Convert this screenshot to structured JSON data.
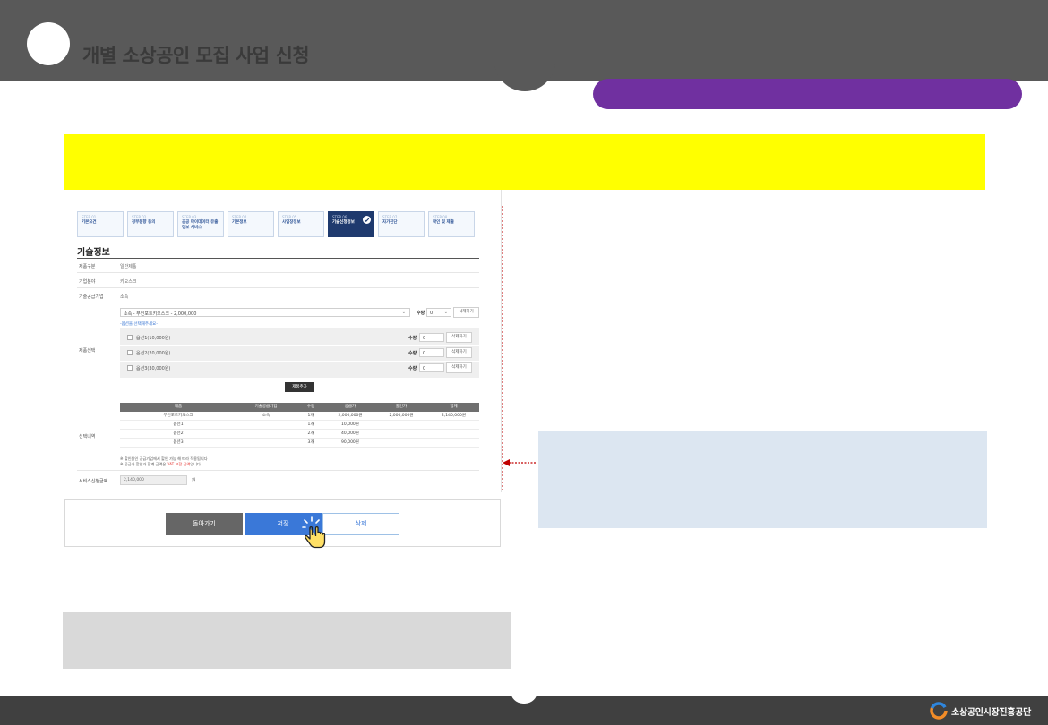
{
  "header": {
    "title": "개별 소상공인 모집 사업 신청"
  },
  "steps": [
    {
      "num": "STEP 01",
      "label": "기본요건"
    },
    {
      "num": "STEP 02",
      "label": "정부동향 동의"
    },
    {
      "num": "STEP 03",
      "label": "공공 마이데이터 유출정보 서비스"
    },
    {
      "num": "STEP 04",
      "label": "기본정보"
    },
    {
      "num": "STEP 05",
      "label": "사업장정보"
    },
    {
      "num": "STEP 06",
      "label": "기술신청정보"
    },
    {
      "num": "STEP 07",
      "label": "자가진단"
    },
    {
      "num": "STEP 08",
      "label": "확인 및 제출"
    }
  ],
  "tech": {
    "heading": "기술정보",
    "rows": [
      {
        "key": "제품구분",
        "value": "일반제품"
      },
      {
        "key": "기업분야",
        "value": "키오스크"
      },
      {
        "key": "기술공급기업",
        "value": "소속"
      }
    ],
    "product_select": {
      "label": "제품선택",
      "value": "소속 - 무인포트키오스크 - 2,000,000",
      "qty_label": "수량",
      "qty_value": "0",
      "remove_label": "삭제하기"
    },
    "option_hint": "-옵션을 선택해주세요-",
    "options": [
      {
        "label": "옵션1(10,000원)",
        "qty": "0",
        "remove": "삭제하기"
      },
      {
        "label": "옵션2(20,000원)",
        "qty": "0",
        "remove": "삭제하기"
      },
      {
        "label": "옵션3(30,000원)",
        "qty": "0",
        "remove": "삭제하기"
      }
    ],
    "add_button": "제품추가",
    "selection_label": "선택내역",
    "table_headers": [
      "제품",
      "기술공급기업",
      "수량",
      "공급가",
      "할인가",
      "합계"
    ],
    "table_rows": [
      [
        "무인포트키오스크",
        "소속",
        "1개",
        "2,000,000원",
        "2,000,000원",
        "2,140,000원"
      ],
      [
        "옵션1",
        "",
        "1개",
        "10,000원",
        "",
        ""
      ],
      [
        "옵션2",
        "",
        "2개",
        "40,000원",
        "",
        ""
      ],
      [
        "옵션3",
        "",
        "3개",
        "90,000원",
        ""
      ]
    ],
    "notes": [
      "※ 할인원인 공급기업에서 할인 가능 해 따라 적용됩니다",
      "※ 공급가 할인가 합계 금액은 ",
      "VAT 포함 금액",
      "입니다."
    ],
    "total_label": "서비스신청금액",
    "total_value": "2,140,000",
    "total_unit": "원"
  },
  "buttons": {
    "back": "돌아가기",
    "save": "저장",
    "delete": "삭제"
  },
  "footer": {
    "org": "소상공인시장진흥공단"
  },
  "colors": {
    "topbar": "#595959",
    "purple": "#7030a0",
    "yellow": "#ffff00",
    "step_active": "#1f3a6e",
    "save_blue": "#3a78d8",
    "bluebox": "#dce6f1",
    "greybox": "#d9d9d9",
    "bottombar": "#404040"
  }
}
